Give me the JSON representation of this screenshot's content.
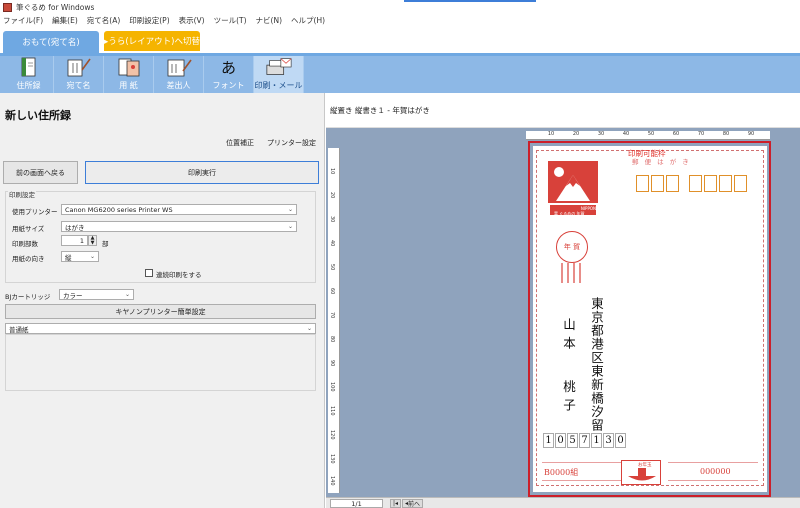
{
  "window": {
    "title": "筆ぐるめ for Windows"
  },
  "menu": [
    "ファイル(F)",
    "編集(E)",
    "宛て名(A)",
    "印刷設定(P)",
    "表示(V)",
    "ツール(T)",
    "ナビ(N)",
    "ヘルプ(H)"
  ],
  "tabs": {
    "front": "おもて(宛て名)",
    "switch": "▸うら(レイアウト)へ切替"
  },
  "toolbar": [
    {
      "label": "住所録",
      "icon": "address-book-icon"
    },
    {
      "label": "宛て名",
      "icon": "addressee-icon"
    },
    {
      "label": "用 紙",
      "icon": "paper-icon"
    },
    {
      "label": "差出人",
      "icon": "sender-icon"
    },
    {
      "label": "フォント",
      "icon": "font-icon",
      "glyph": "あ"
    },
    {
      "label": "印刷・メール",
      "icon": "printer-icon",
      "active": true
    }
  ],
  "left": {
    "title": "新しい住所録",
    "link_position": "位置補正",
    "link_printer": "プリンター設定",
    "back_button": "前の画面へ戻る",
    "print_button": "印刷実行",
    "group_label": "印刷設定",
    "printer_label": "使用プリンター",
    "printer_value": "Canon MG6200 series Printer WS",
    "paper_label": "用紙サイズ",
    "paper_value": "はがき",
    "copies_label": "印刷部数",
    "copies_value": "1",
    "copies_unit": "部",
    "orient_label": "用紙の向き",
    "orient_value": "縦",
    "continuous_label": "連続印刷をする",
    "cartridge_label": "BJカートリッジ",
    "cartridge_value": "カラー",
    "canon_easy_button": "キヤノンプリンター簡単設定",
    "media_value": "普通紙"
  },
  "preview": {
    "caption": "縦置き 縦書き１ - 年賀はがき",
    "ruler_top": [
      "10",
      "20",
      "30",
      "40",
      "50",
      "60",
      "70",
      "80",
      "90"
    ],
    "ruler_left": [
      "10",
      "20",
      "30",
      "40",
      "50",
      "60",
      "70",
      "80",
      "90",
      "100",
      "110",
      "120",
      "130",
      "140"
    ],
    "printable_label": "印刷可能枠",
    "card_sub": "郵 便 は が き",
    "stamp_text": "NIPPON",
    "stamp_caption": "富 ぐるめの 年賀",
    "postmark_text": "年 賀",
    "address_col1": "東京都港区東新橋汐留",
    "name_col1": "山 本",
    "name_col2": "桃 子",
    "sender_zip": [
      "1",
      "0",
      "5",
      "7",
      "1",
      "3",
      "0"
    ],
    "lottery_left": "B0000組",
    "lottery_right": "000000",
    "prize_label": "お年玉"
  },
  "status": {
    "page": "1/1",
    "prev": "前へ"
  },
  "colors": {
    "accent": "#3d7ed8",
    "tab_orange": "#f5b400",
    "toolbar_blue": "#8db8e6",
    "card_red": "#cc1f2a",
    "zip_orange": "#e0902a"
  }
}
